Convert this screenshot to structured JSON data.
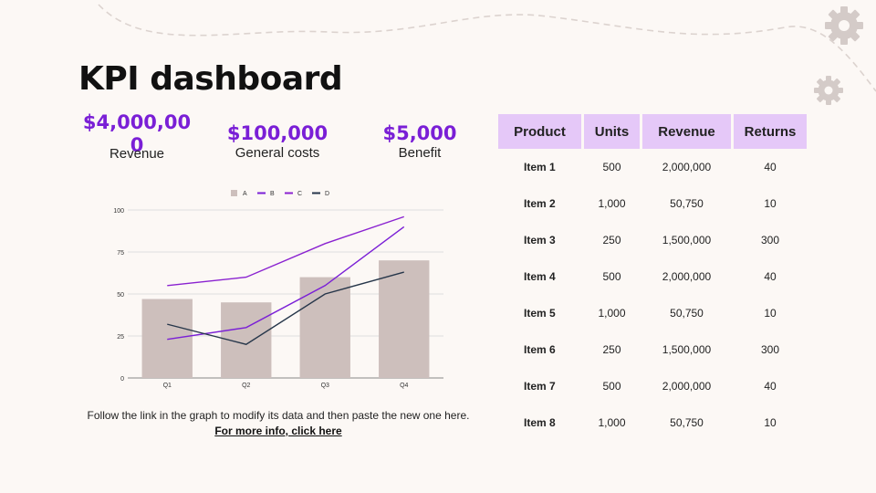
{
  "title": "KPI dashboard",
  "kpis": [
    {
      "value": "$4,000,000",
      "label": "Revenue"
    },
    {
      "value": "$100,000",
      "label": "General costs"
    },
    {
      "value": "$5,000",
      "label": "Benefit"
    }
  ],
  "note": {
    "text": "Follow the link in the graph to modify its data and then paste the new one here.",
    "link_text": "For more info, click here"
  },
  "colors": {
    "accent": "#7a1fd6",
    "header_bg": "#e5c8f8",
    "background": "#fcf8f5"
  },
  "icons": [
    "gear-icon",
    "gear-icon"
  ],
  "table": {
    "headers": [
      "Product",
      "Units",
      "Revenue",
      "Returns"
    ],
    "rows": [
      [
        "Item 1",
        "500",
        "2,000,000",
        "40"
      ],
      [
        "Item 2",
        "1,000",
        "50,750",
        "10"
      ],
      [
        "Item 3",
        "250",
        "1,500,000",
        "300"
      ],
      [
        "Item 4",
        "500",
        "2,000,000",
        "40"
      ],
      [
        "Item 5",
        "1,000",
        "50,750",
        "10"
      ],
      [
        "Item 6",
        "250",
        "1,500,000",
        "300"
      ],
      [
        "Item 7",
        "500",
        "2,000,000",
        "40"
      ],
      [
        "Item 8",
        "1,000",
        "50,750",
        "10"
      ]
    ]
  },
  "chart_data": {
    "type": "bar",
    "categories": [
      "Q1",
      "Q2",
      "Q3",
      "Q4"
    ],
    "ylim": [
      0,
      100
    ],
    "yticks": [
      0,
      25,
      50,
      75,
      100
    ],
    "grid": true,
    "legend_position": "top",
    "series": [
      {
        "name": "A",
        "type": "bar",
        "color": "#cdbfbc",
        "values": [
          47,
          45,
          60,
          70
        ]
      },
      {
        "name": "B",
        "type": "line",
        "color": "#7a1fd6",
        "values": [
          23,
          30,
          55,
          90
        ]
      },
      {
        "name": "C",
        "type": "line",
        "color": "#8a22d0",
        "values": [
          55,
          60,
          80,
          96
        ]
      },
      {
        "name": "D",
        "type": "line",
        "color": "#26364a",
        "values": [
          32,
          20,
          50,
          63
        ]
      }
    ]
  }
}
